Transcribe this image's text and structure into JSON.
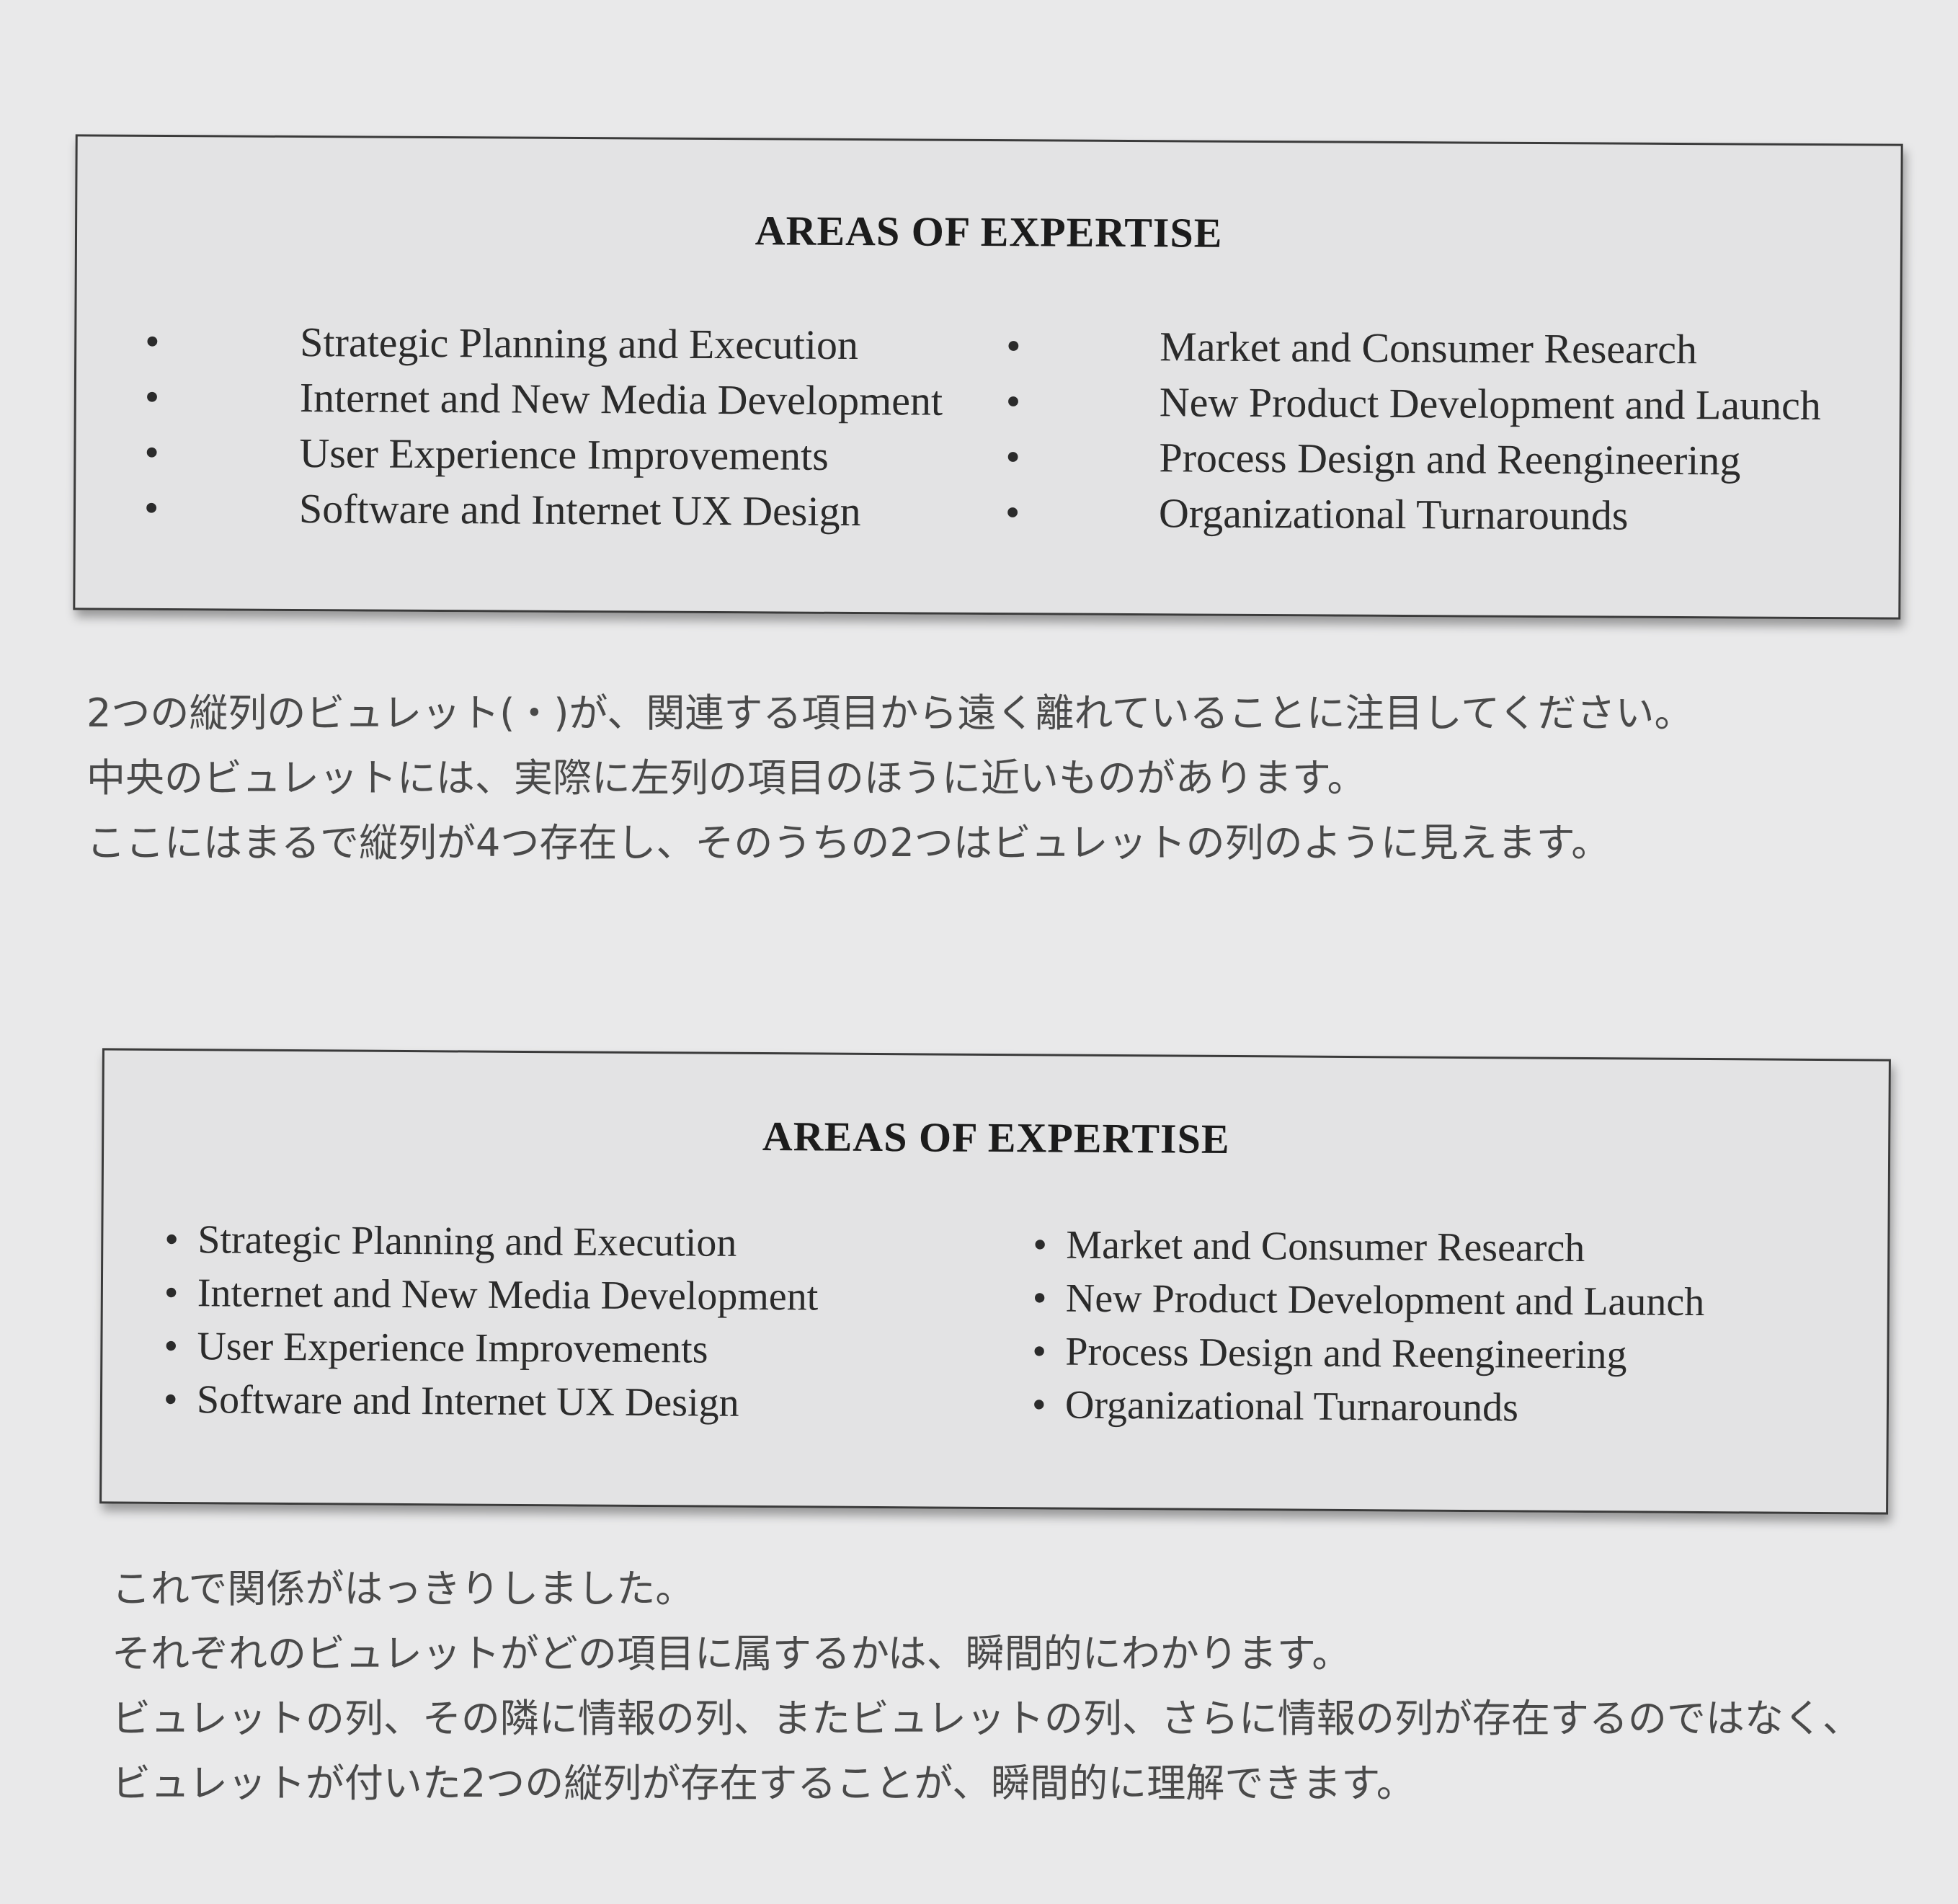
{
  "example_before": {
    "title": "AREAS OF EXPERTISE",
    "left_items": [
      "Strategic Planning and Execution",
      "Internet and New Media Development",
      "User Experience Improvements",
      "Software and Internet UX Design"
    ],
    "right_items": [
      "Market and Consumer Research",
      "New Product Development and Launch",
      "Process Design and Reengineering",
      "Organizational Turnarounds"
    ],
    "bullet": "•"
  },
  "caption_before": [
    "2つの縦列のビュレット(・)が、関連する項目から遠く離れていることに注目してください。",
    "中央のビュレットには、実際に左列の項目のほうに近いものがあります。",
    "ここにはまるで縦列が4つ存在し、そのうちの2つはビュレットの列のように見えます。"
  ],
  "example_after": {
    "title": "AREAS OF EXPERTISE",
    "left_items": [
      "Strategic Planning and Execution",
      "Internet and New Media Development",
      "User Experience Improvements",
      "Software and Internet UX Design"
    ],
    "right_items": [
      "Market and Consumer Research",
      "New Product Development and Launch",
      "Process Design and Reengineering",
      "Organizational Turnarounds"
    ],
    "bullet": "•"
  },
  "caption_after": [
    "これで関係がはっきりしました。",
    "それぞれのビュレットがどの項目に属するかは、瞬間的にわかります。",
    "ビュレットの列、その隣に情報の列、またビュレットの列、さらに情報の列が存在するのではなく、",
    "ビュレットが付いた2つの縦列が存在することが、瞬間的に理解できます。"
  ]
}
